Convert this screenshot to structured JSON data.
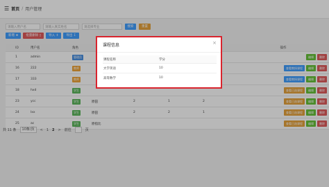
{
  "breadcrumb": {
    "menu_icon": "menu-icon",
    "home": "首页",
    "separator": "/",
    "current": "用户管理"
  },
  "search": {
    "field1_placeholder": "请输入用户名",
    "field2_placeholder": "请输入真实姓名",
    "field3_placeholder": "请选择专业",
    "search_label": "搜索",
    "reset_label": "重置"
  },
  "toolbar": {
    "add_label": "新增",
    "batch_delete_label": "批量删除",
    "import_label": "导入",
    "export_label": "导出"
  },
  "table": {
    "columns": [
      "ID",
      "用户名",
      "角色",
      "",
      "",
      "",
      "",
      "操作"
    ],
    "rows": [
      {
        "id": "1",
        "username": "admin",
        "role": "管理员",
        "role_color": "#4a90e2",
        "c4": "",
        "c5": "",
        "c6": "",
        "c7": "",
        "btn_course": "",
        "btn_edit": "编辑",
        "btn_del": "删除"
      },
      {
        "id": "16",
        "username": "222",
        "role": "教师",
        "role_color": "#f0a53a",
        "c4": "",
        "c5": "",
        "c6": "",
        "c7": "",
        "btn_course": "查看教授课程",
        "btn_edit": "编辑",
        "btn_del": "删除"
      },
      {
        "id": "17",
        "username": "333",
        "role": "教师",
        "role_color": "#f0a53a",
        "c4": "",
        "c5": "",
        "c6": "",
        "c7": "",
        "btn_course": "查看教授课程",
        "btn_edit": "编辑",
        "btn_del": "删除"
      },
      {
        "id": "18",
        "username": "hxd",
        "role": "学生",
        "role_color": "#5cb85c",
        "c4": "",
        "c5": "",
        "c6": "",
        "c7": "",
        "btn_course": "查看已选课程",
        "btn_edit": "编辑",
        "btn_del": "删除"
      },
      {
        "id": "23",
        "username": "ycc",
        "role": "学生",
        "role_color": "#5cb85c",
        "c4": "原田",
        "c5": "2",
        "c6": "1",
        "c7": "2",
        "btn_course": "查看已选课程",
        "btn_edit": "编辑",
        "btn_del": "删除"
      },
      {
        "id": "24",
        "username": "lxx",
        "role": "学生",
        "role_color": "#5cb85c",
        "c4": "原田",
        "c5": "2",
        "c6": "2",
        "c7": "1",
        "btn_course": "查看已选课程",
        "btn_edit": "编辑",
        "btn_del": "删除"
      },
      {
        "id": "25",
        "username": "ac",
        "role": "学生",
        "role_color": "#5cb85c",
        "c4": "原指比",
        "c5": "",
        "c6": "",
        "c7": "",
        "btn_course": "查看已选课程",
        "btn_edit": "编辑",
        "btn_del": "删除"
      }
    ]
  },
  "pagination": {
    "total": "共 11 条",
    "page_size": "10条/页",
    "prev": "<",
    "pages": [
      "1",
      "2"
    ],
    "active_page": "2",
    "next": ">",
    "goto_label": "前往",
    "page_unit": "页"
  },
  "modal": {
    "title": "课程信息",
    "close": "×",
    "columns": [
      "课程名称",
      "学分"
    ],
    "rows": [
      {
        "name": "大学英语",
        "credit": "10"
      },
      {
        "name": "高等数学",
        "credit": "10"
      }
    ]
  },
  "colors": {
    "primary": "#409eff",
    "danger": "#e05b5b",
    "warning": "#e6a23c",
    "success": "#67c23a",
    "highlight": "#d9232d"
  }
}
